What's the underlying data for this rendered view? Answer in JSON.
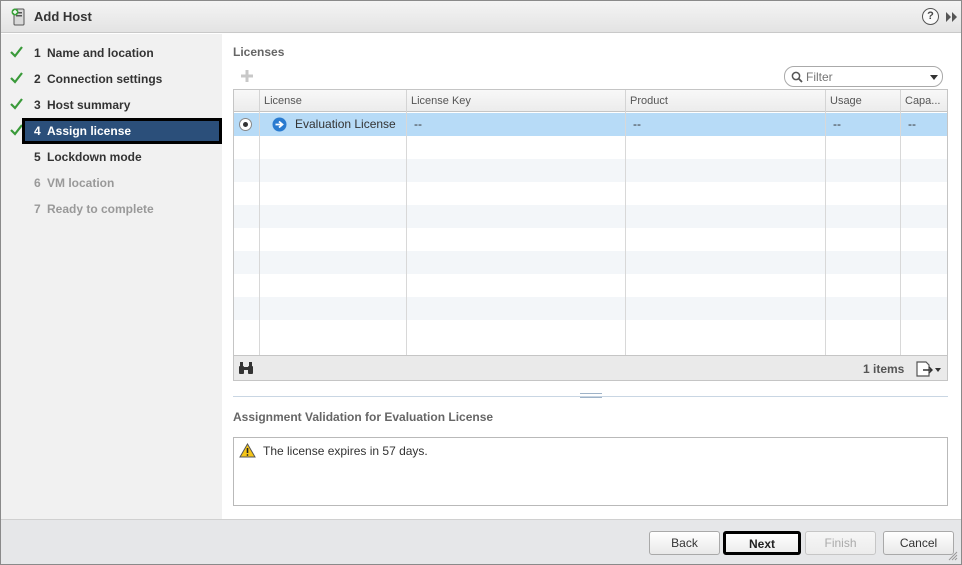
{
  "window": {
    "title": "Add Host",
    "help_symbol": "?"
  },
  "steps": [
    {
      "num": "1",
      "label": "Name and location",
      "state": "done"
    },
    {
      "num": "2",
      "label": "Connection settings",
      "state": "done"
    },
    {
      "num": "3",
      "label": "Host summary",
      "state": "done"
    },
    {
      "num": "4",
      "label": "Assign license",
      "state": "active"
    },
    {
      "num": "5",
      "label": "Lockdown mode",
      "state": "todo"
    },
    {
      "num": "6",
      "label": "VM location",
      "state": "disabled"
    },
    {
      "num": "7",
      "label": "Ready to complete",
      "state": "disabled"
    }
  ],
  "licenses": {
    "title": "Licenses",
    "filter_placeholder": "Filter",
    "columns": [
      "License",
      "License Key",
      "Product",
      "Usage",
      "Capa..."
    ],
    "rows": [
      {
        "license": "Evaluation License",
        "key": "--",
        "product": "--",
        "usage": "--",
        "capacity": "--",
        "selected": true
      }
    ],
    "items_count": "1 items"
  },
  "validation": {
    "title": "Assignment Validation for Evaluation License",
    "message": "The license expires in 57 days."
  },
  "buttons": {
    "back": "Back",
    "next": "Next",
    "finish": "Finish",
    "cancel": "Cancel"
  },
  "colors": {
    "active_step": "#2b4f7a",
    "selected_row": "#b7dbf7",
    "check": "#3a9a3a"
  }
}
